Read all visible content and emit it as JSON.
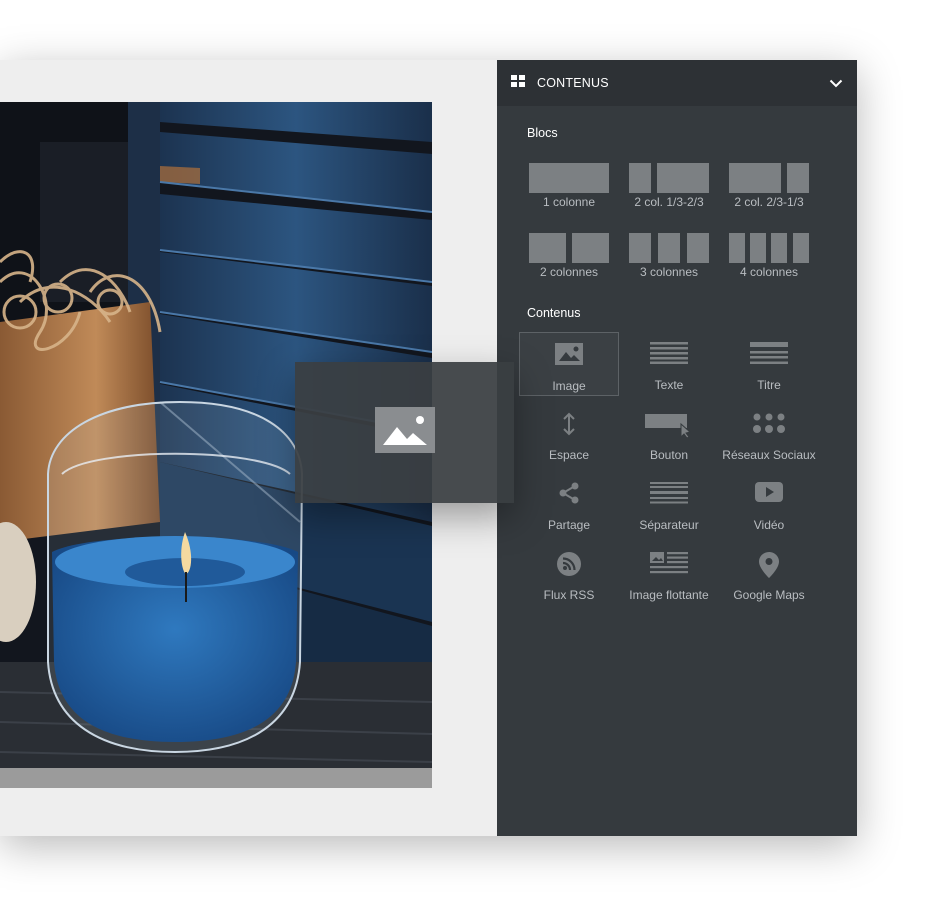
{
  "panel": {
    "title": "CONTENUS",
    "header_icon": "grid-icon",
    "collapse_icon": "chevron-down-icon"
  },
  "blocs": {
    "title": "Blocs",
    "items": [
      {
        "label": "1 colonne"
      },
      {
        "label": "2 col. 1/3-2/3"
      },
      {
        "label": "2 col. 2/3-1/3"
      },
      {
        "label": "2 colonnes"
      },
      {
        "label": "3 colonnes"
      },
      {
        "label": "4 colonnes"
      }
    ]
  },
  "contenus": {
    "title": "Contenus",
    "items": [
      {
        "label": "Image",
        "icon": "image-icon",
        "selected": true
      },
      {
        "label": "Texte",
        "icon": "text-icon"
      },
      {
        "label": "Titre",
        "icon": "title-icon"
      },
      {
        "label": "Espace",
        "icon": "vertical-arrows-icon"
      },
      {
        "label": "Bouton",
        "icon": "button-icon"
      },
      {
        "label": "Réseaux Sociaux",
        "icon": "social-dots-icon"
      },
      {
        "label": "Partage",
        "icon": "share-icon"
      },
      {
        "label": "Séparateur",
        "icon": "separator-icon"
      },
      {
        "label": "Vidéo",
        "icon": "video-play-icon"
      },
      {
        "label": "Flux RSS",
        "icon": "rss-icon"
      },
      {
        "label": "Image flottante",
        "icon": "floating-image-icon"
      },
      {
        "label": "Google Maps",
        "icon": "map-pin-icon"
      }
    ]
  },
  "drag_ghost": {
    "icon": "image-icon"
  },
  "colors": {
    "sidebar_bg": "#353a3e",
    "header_bg": "#2d3135",
    "icon_gray": "#7c8083",
    "label_gray": "#b9bdc1",
    "canvas_bg": "#eeeeee"
  }
}
